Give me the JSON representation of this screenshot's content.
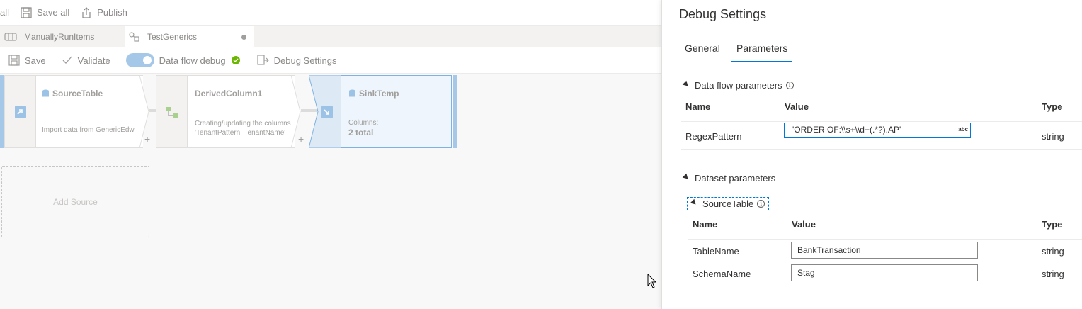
{
  "toolbar": {
    "all_label": "all",
    "save_all_label": "Save all",
    "publish_label": "Publish"
  },
  "tabs": [
    {
      "label": "ManuallyRunItems"
    },
    {
      "label": "TestGenerics"
    }
  ],
  "dataflow_toolbar": {
    "save_label": "Save",
    "validate_label": "Validate",
    "debug_label": "Data flow debug",
    "debug_settings_label": "Debug Settings"
  },
  "nodes": {
    "source": {
      "title": "SourceTable",
      "desc": "Import data from GenericEdw"
    },
    "derived": {
      "title": "DerivedColumn1",
      "desc_line1": "Creating/updating the columns",
      "desc_line2": "'TenantPattern, TenantName'"
    },
    "sink": {
      "title": "SinkTemp",
      "columns_label": "Columns:",
      "columns_value": "2 total"
    },
    "plus": "+"
  },
  "add_source_label": "Add Source",
  "panel": {
    "title": "Debug Settings",
    "tabs": [
      "General",
      "Parameters"
    ],
    "active_tab": "Parameters",
    "dataflow_params": {
      "heading": "Data flow parameters",
      "col_name": "Name",
      "col_value": "Value",
      "col_type": "Type",
      "rows": [
        {
          "name": "RegexPattern",
          "value": "'ORDER OF:\\\\s+\\\\d+(.*?).AP'",
          "badge": "abc",
          "type": "string"
        }
      ]
    },
    "dataset_params": {
      "heading": "Dataset parameters",
      "group": "SourceTable",
      "col_name": "Name",
      "col_value": "Value",
      "col_type": "Type",
      "rows": [
        {
          "name": "TableName",
          "value": "BankTransaction",
          "type": "string"
        },
        {
          "name": "SchemaName",
          "value": "Stag",
          "type": "string"
        }
      ]
    }
  },
  "colors": {
    "accent": "#0078d4",
    "toggle": "#a5c8e8",
    "success": "#6bb700"
  }
}
